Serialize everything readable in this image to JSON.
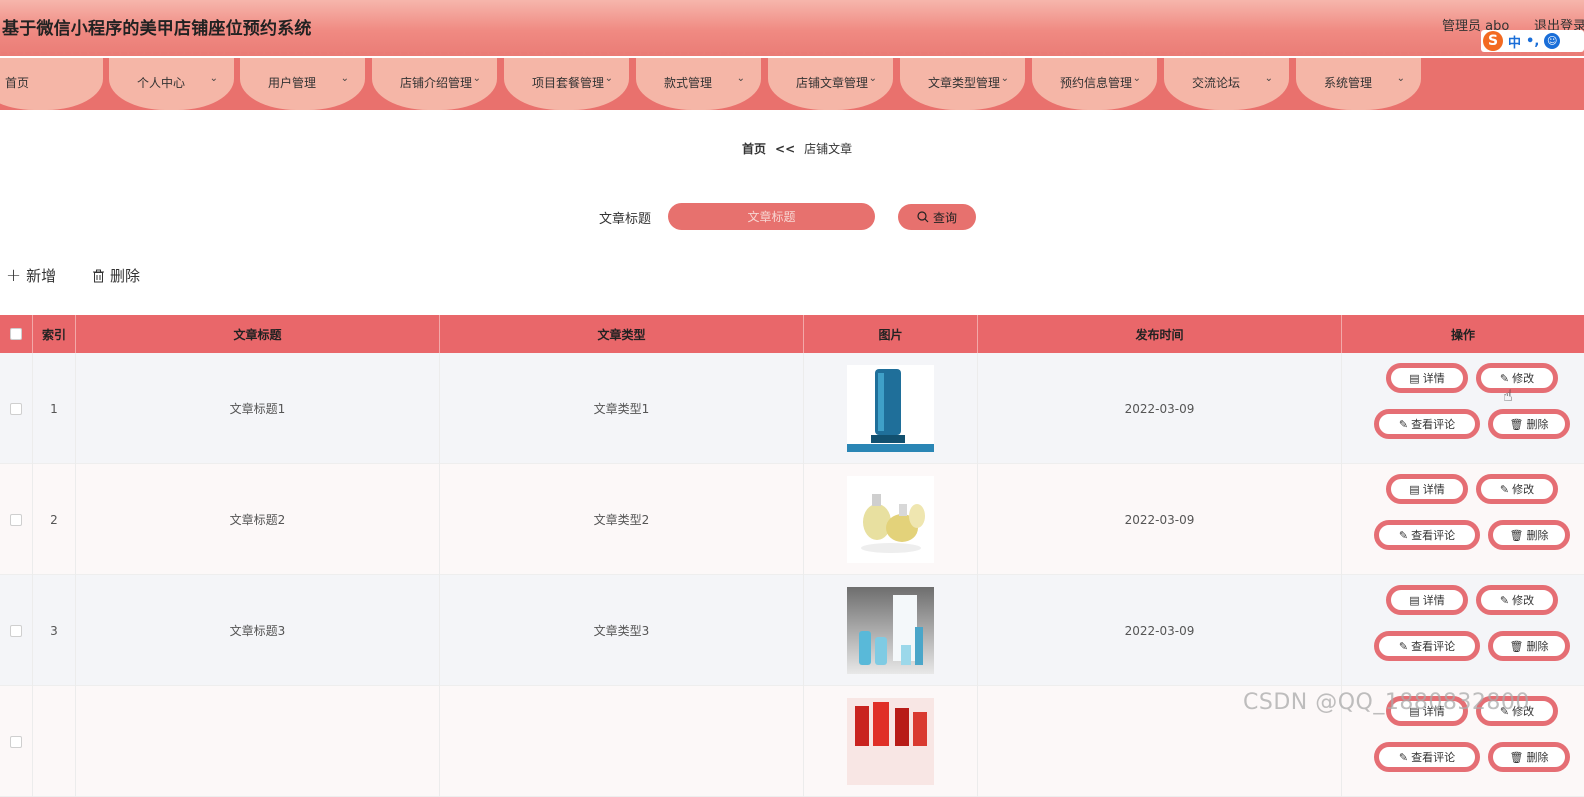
{
  "header": {
    "title": "基于微信小程序的美甲店铺座位预约系统",
    "user": "管理员 abo",
    "logout": "退出登录"
  },
  "ime": {
    "logo": "S",
    "lang": "中",
    "punct": "•,",
    "emoji": "☺"
  },
  "nav": {
    "items": [
      {
        "label": "首页",
        "has_dropdown": false
      },
      {
        "label": "个人中心",
        "has_dropdown": true
      },
      {
        "label": "用户管理",
        "has_dropdown": true
      },
      {
        "label": "店铺介绍管理",
        "has_dropdown": true
      },
      {
        "label": "项目套餐管理",
        "has_dropdown": true
      },
      {
        "label": "款式管理",
        "has_dropdown": true
      },
      {
        "label": "店铺文章管理",
        "has_dropdown": true
      },
      {
        "label": "文章类型管理",
        "has_dropdown": true
      },
      {
        "label": "预约信息管理",
        "has_dropdown": true
      },
      {
        "label": "交流论坛",
        "has_dropdown": true
      },
      {
        "label": "系统管理",
        "has_dropdown": true
      }
    ]
  },
  "breadcrumb": {
    "home": "首页",
    "separator": "<<",
    "current": "店铺文章"
  },
  "search": {
    "label": "文章标题",
    "placeholder": "文章标题",
    "button": "查询"
  },
  "toolbar": {
    "add": "新增",
    "delete": "删除"
  },
  "table": {
    "columns": [
      "索引",
      "文章标题",
      "文章类型",
      "图片",
      "发布时间",
      "操作"
    ],
    "rows": [
      {
        "index": "1",
        "title": "文章标题1",
        "type": "文章类型1",
        "image": "blue-tube",
        "date": "2022-03-09"
      },
      {
        "index": "2",
        "title": "文章标题2",
        "type": "文章类型2",
        "image": "yellow-bottles",
        "date": "2022-03-09"
      },
      {
        "index": "3",
        "title": "文章标题3",
        "type": "文章类型3",
        "image": "cyan-bottles",
        "date": "2022-03-09"
      },
      {
        "index": "",
        "title": "",
        "type": "",
        "image": "red-bottles",
        "date": ""
      }
    ],
    "actions": {
      "detail": "详情",
      "edit": "修改",
      "comments": "查看评论",
      "delete": "删除"
    }
  },
  "watermark": "CSDN @QQ_1880832800",
  "colors": {
    "accent": "#e9716d",
    "nav_item": "#f5b6a7",
    "header_top": "#f6b6ac"
  }
}
